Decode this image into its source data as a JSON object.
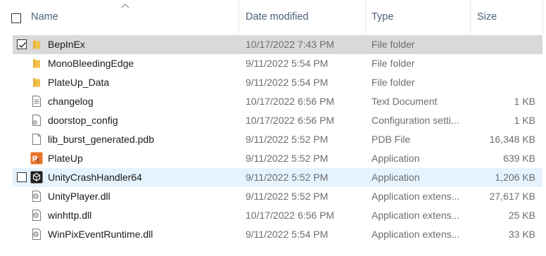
{
  "header": {
    "name_label": "Name",
    "date_label": "Date modified",
    "type_label": "Type",
    "size_label": "Size",
    "sort_icon": "chevron-up-icon"
  },
  "colors": {
    "folder": "#f2c14e",
    "selected_row": "#d9d9d9",
    "hover_row": "#e5f3ff",
    "header_text": "#4c607a"
  },
  "files": [
    {
      "name": "BepInEx",
      "date": "10/17/2022 7:43 PM",
      "type": "File folder",
      "size": "",
      "icon": "folder-icon",
      "state": "selected",
      "checked": true
    },
    {
      "name": "MonoBleedingEdge",
      "date": "9/11/2022 5:54 PM",
      "type": "File folder",
      "size": "",
      "icon": "folder-icon",
      "state": "normal",
      "checked": false
    },
    {
      "name": "PlateUp_Data",
      "date": "9/11/2022 5:54 PM",
      "type": "File folder",
      "size": "",
      "icon": "folder-icon",
      "state": "normal",
      "checked": false
    },
    {
      "name": "changelog",
      "date": "10/17/2022 6:56 PM",
      "type": "Text Document",
      "size": "1 KB",
      "icon": "text-document-icon",
      "state": "normal",
      "checked": false
    },
    {
      "name": "doorstop_config",
      "date": "10/17/2022 6:56 PM",
      "type": "Configuration setti...",
      "size": "1 KB",
      "icon": "config-file-icon",
      "state": "normal",
      "checked": false
    },
    {
      "name": "lib_burst_generated.pdb",
      "date": "9/11/2022 5:52 PM",
      "type": "PDB File",
      "size": "16,348 KB",
      "icon": "blank-file-icon",
      "state": "normal",
      "checked": false
    },
    {
      "name": "PlateUp",
      "date": "9/11/2022 5:52 PM",
      "type": "Application",
      "size": "639 KB",
      "icon": "plateup-app-icon",
      "state": "normal",
      "checked": false
    },
    {
      "name": "UnityCrashHandler64",
      "date": "9/11/2022 5:52 PM",
      "type": "Application",
      "size": "1,206 KB",
      "icon": "unity-app-icon",
      "state": "hover",
      "checked": false
    },
    {
      "name": "UnityPlayer.dll",
      "date": "9/11/2022 5:52 PM",
      "type": "Application extens...",
      "size": "27,617 KB",
      "icon": "dll-file-icon",
      "state": "normal",
      "checked": false
    },
    {
      "name": "winhttp.dll",
      "date": "10/17/2022 6:56 PM",
      "type": "Application extens...",
      "size": "25 KB",
      "icon": "dll-file-icon",
      "state": "normal",
      "checked": false
    },
    {
      "name": "WinPixEventRuntime.dll",
      "date": "9/11/2022 5:54 PM",
      "type": "Application extens...",
      "size": "33 KB",
      "icon": "dll-file-icon",
      "state": "normal",
      "checked": false
    }
  ]
}
